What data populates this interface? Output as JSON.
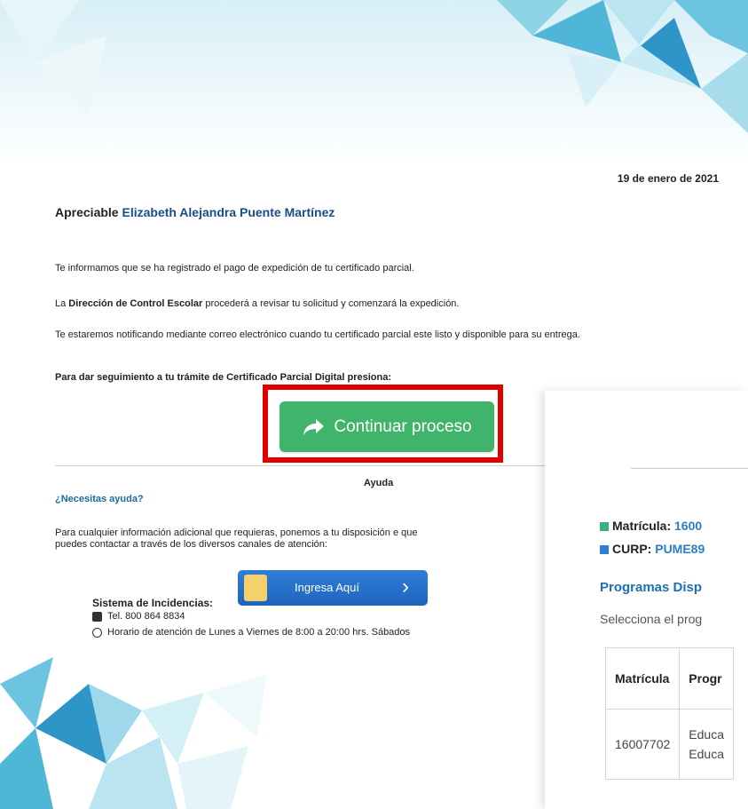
{
  "email": {
    "date": "19 de enero de 2021",
    "greeting_prefix": "Apreciable",
    "recipient_name": "Elizabeth Alejandra Puente Martínez",
    "para1": "Te informamos que se ha registrado el pago de expedición de tu certificado parcial.",
    "para2_pre": "La ",
    "para2_bold": "Dirección de Control Escolar",
    "para2_post": " procederá a revisar tu solicitud y comenzará la expedición.",
    "para3": "Te estaremos notificando mediante correo electrónico cuando tu certificado parcial este listo y disponible para su entrega.",
    "para4": "Para dar seguimiento a tu trámite de Certificado Parcial Digital presiona:",
    "cta_label": "Continuar proceso",
    "help_title": "Ayuda",
    "help_question": "¿Necesitas ayuda?",
    "help_text": "Para cualquier información adicional que requieras, ponemos a tu disposición e que puedes contactar a través de los diversos canales de atención:",
    "incidencias_label": "Sistema de Incidencias:",
    "ingresa_label": "Ingresa Aquí",
    "phone": "Tel. 800 864 8834",
    "hours": "Horario de atención de Lunes a Viernes de 8:00 a 20:00 hrs. Sábados"
  },
  "panel": {
    "matricula_label": "Matrícula:",
    "matricula_value": "1600",
    "curp_label": "CURP:",
    "curp_value": "PUME89",
    "programs_title": "Programas Disp",
    "programs_sub": "Selecciona el prog",
    "table": {
      "headers": [
        "Matrícula",
        "Progr"
      ],
      "rows": [
        [
          "16007702",
          "Educa",
          "Educa"
        ]
      ]
    }
  },
  "colors": {
    "accent_blue": "#1f6fb3",
    "cta_green": "#3fb46a",
    "highlight_red": "#e00000",
    "bullet_green": "#3bb27d",
    "bullet_blue": "#2f7fd6"
  }
}
